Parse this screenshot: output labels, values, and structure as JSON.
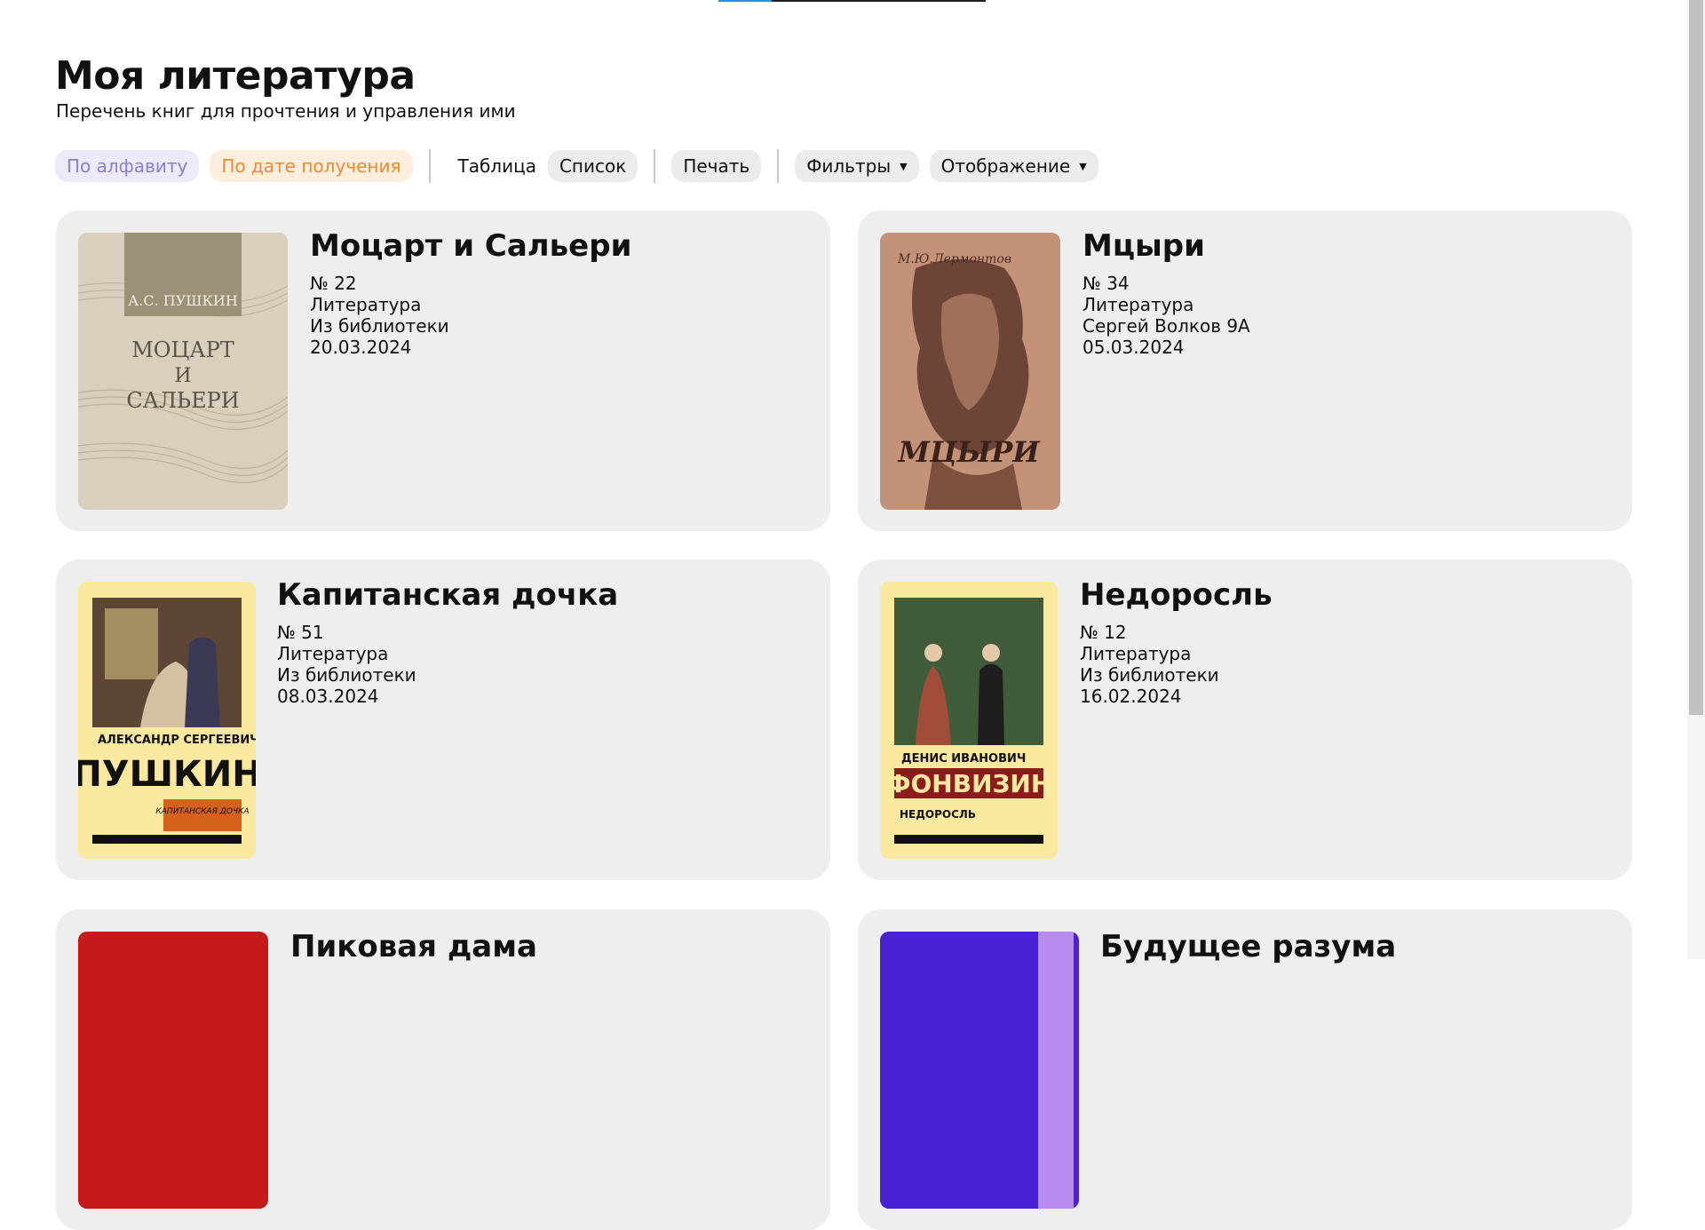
{
  "page": {
    "title": "Моя литература",
    "subtitle": "Перечень книг для прочтения и управления ими"
  },
  "toolbar": {
    "sort_alpha": "По алфавиту",
    "sort_date": "По дате получения",
    "view_table": "Таблица",
    "view_list": "Список",
    "print": "Печать",
    "filters": "Фильтры",
    "display": "Отображение"
  },
  "books": [
    {
      "title": "Моцарт и Сальери",
      "number": "№ 22",
      "category": "Литература",
      "source": "Из библиотеки",
      "date": "20.03.2024",
      "cover": {
        "author": "А.С. ПУШКИН",
        "line1": "МОЦАРТ",
        "line2": "И",
        "line3": "САЛЬЕРИ"
      }
    },
    {
      "title": "Мцыри",
      "number": "№ 34",
      "category": "Литература",
      "source": "Сергей Волков 9А",
      "date": "05.03.2024",
      "cover": {
        "author": "М.Ю.Лермонтов",
        "line1": "МЦЫРИ"
      }
    },
    {
      "title": "Капитанская дочка",
      "number": "№ 51",
      "category": "Литература",
      "source": "Из библиотеки",
      "date": "08.03.2024",
      "cover": {
        "author": "АЛЕКСАНДР СЕРГЕЕВИЧ",
        "line1": "ПУШКИН",
        "line2": "КАПИТАНСКАЯ ДОЧКА"
      }
    },
    {
      "title": "Недоросль",
      "number": "№ 12",
      "category": "Литература",
      "source": "Из библиотеки",
      "date": "16.02.2024",
      "cover": {
        "author": "ДЕНИС ИВАНОВИЧ",
        "line1": "ФОНВИЗИН",
        "line2": "НЕДОРОСЛЬ"
      }
    },
    {
      "title": "Пиковая дама"
    },
    {
      "title": "Будущее разума"
    }
  ],
  "colors": {
    "accent_blue": "#2a8de0",
    "alpha_pill_text": "#8a7fd6",
    "date_pill_text": "#ef8a30",
    "card_bg": "#eeeeee"
  }
}
